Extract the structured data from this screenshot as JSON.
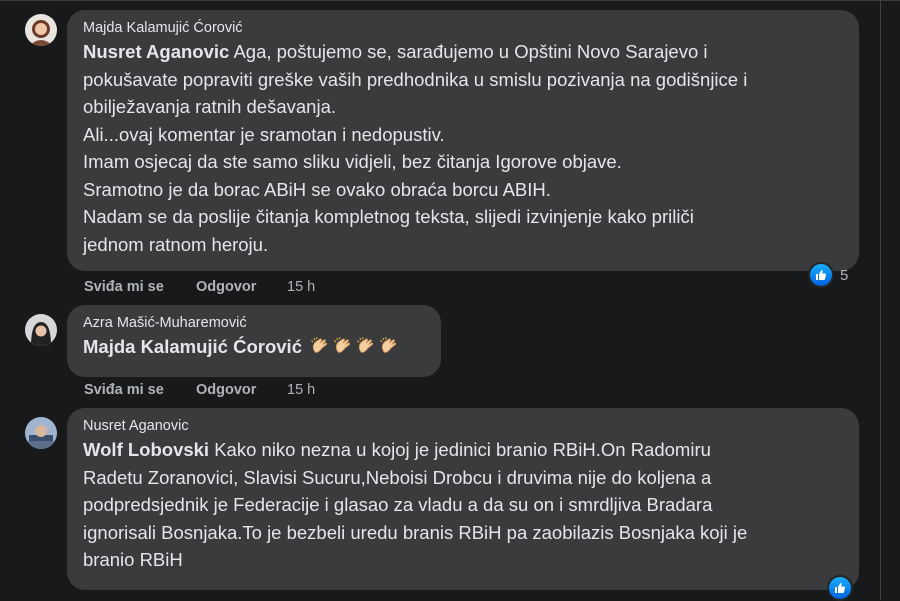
{
  "comments": [
    {
      "author": "Majda Kalamujić Ćorović",
      "mention": "Nusret Aganovic",
      "lines": [
        " Aga, poštujemo se, sarađujemo u Opštini Novo Sarajevo i",
        "pokušavate popraviti greške vaših predhodnika u smislu pozivanja na godišnjice i",
        "obilježavanja ratnih dešavanja.",
        "Ali...ovaj komentar je sramotan i nedopustiv.",
        "Imam osjecaj da ste samo sliku vidjeli, bez čitanja Igorove objave.",
        "Sramotno je da borac ABiH se ovako obraća borcu ABIH.",
        "Nadam se da poslije čitanja kompletnog teksta, slijedi izvinjenje kako priliči",
        "jednom ratnom heroju."
      ],
      "like_label": "Sviđa mi se",
      "reply_label": "Odgovor",
      "time": "15 h",
      "reaction_count": "5",
      "reaction_icon": "like-icon"
    },
    {
      "author": "Azra Mašić-Muharemović",
      "mention": "Majda Kalamujić Ćorović",
      "emoji": [
        "clapping-hands",
        "clapping-hands",
        "clapping-hands",
        "clapping-hands"
      ],
      "like_label": "Sviđa mi se",
      "reply_label": "Odgovor",
      "time": "15 h"
    },
    {
      "author": "Nusret Aganovic",
      "mention": "Wolf Lobovski",
      "lines": [
        " Kako niko nezna u kojoj je jedinici branio RBiH.On Radomiru",
        "Radetu Zoranovici, Slavisi Sucuru,Neboisi Drobcu i druvima nije do koljena a",
        "podpredsjednik je Federacije i glasao za vladu a da su on i smrdljiva Bradara",
        "ignorisali Bosnjaka.To je bezbeli uredu branis RBiH pa zaobilazis Bosnjaka koji je",
        "branio RBiH"
      ],
      "reaction_icon": "like-icon"
    }
  ],
  "colors": {
    "background": "#18191a",
    "bubble": "#3a3b3c",
    "text": "#e4e6eb",
    "muted": "#b0b3b8",
    "like_blue": "#1877f2"
  }
}
